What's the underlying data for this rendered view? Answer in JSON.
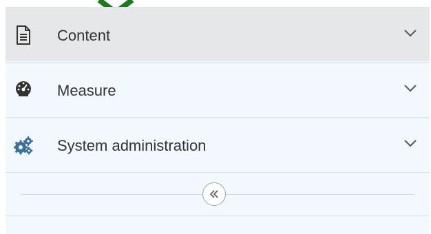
{
  "nav": {
    "items": [
      {
        "label": "Content",
        "icon": "document-icon",
        "active": true
      },
      {
        "label": "Measure",
        "icon": "gauge-icon",
        "active": false
      },
      {
        "label": "System administration",
        "icon": "gears-icon",
        "active": false
      }
    ],
    "collapse_icon": "double-chevron-left-icon"
  },
  "colors": {
    "panel_bg": "#f2f8fd",
    "active_bg": "#e6e7e8",
    "divider": "#d6e5f2",
    "text": "#333333",
    "pointer_marker": "#1f7a1f"
  }
}
